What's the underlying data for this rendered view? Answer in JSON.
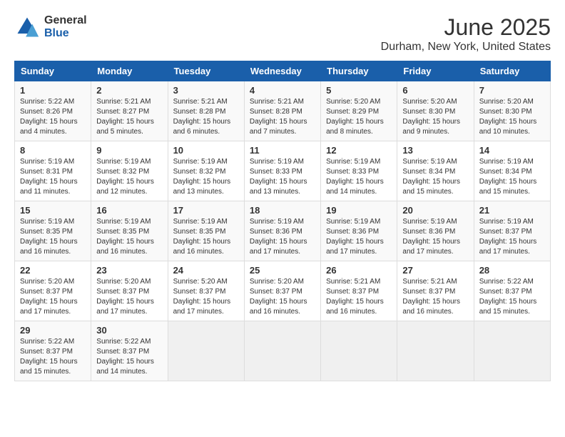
{
  "logo": {
    "general": "General",
    "blue": "Blue"
  },
  "title": "June 2025",
  "subtitle": "Durham, New York, United States",
  "weekdays": [
    "Sunday",
    "Monday",
    "Tuesday",
    "Wednesday",
    "Thursday",
    "Friday",
    "Saturday"
  ],
  "weeks": [
    [
      {
        "day": "1",
        "sunrise": "5:22 AM",
        "sunset": "8:26 PM",
        "daylight": "15 hours and 4 minutes."
      },
      {
        "day": "2",
        "sunrise": "5:21 AM",
        "sunset": "8:27 PM",
        "daylight": "15 hours and 5 minutes."
      },
      {
        "day": "3",
        "sunrise": "5:21 AM",
        "sunset": "8:28 PM",
        "daylight": "15 hours and 6 minutes."
      },
      {
        "day": "4",
        "sunrise": "5:21 AM",
        "sunset": "8:28 PM",
        "daylight": "15 hours and 7 minutes."
      },
      {
        "day": "5",
        "sunrise": "5:20 AM",
        "sunset": "8:29 PM",
        "daylight": "15 hours and 8 minutes."
      },
      {
        "day": "6",
        "sunrise": "5:20 AM",
        "sunset": "8:30 PM",
        "daylight": "15 hours and 9 minutes."
      },
      {
        "day": "7",
        "sunrise": "5:20 AM",
        "sunset": "8:30 PM",
        "daylight": "15 hours and 10 minutes."
      }
    ],
    [
      {
        "day": "8",
        "sunrise": "5:19 AM",
        "sunset": "8:31 PM",
        "daylight": "15 hours and 11 minutes."
      },
      {
        "day": "9",
        "sunrise": "5:19 AM",
        "sunset": "8:32 PM",
        "daylight": "15 hours and 12 minutes."
      },
      {
        "day": "10",
        "sunrise": "5:19 AM",
        "sunset": "8:32 PM",
        "daylight": "15 hours and 13 minutes."
      },
      {
        "day": "11",
        "sunrise": "5:19 AM",
        "sunset": "8:33 PM",
        "daylight": "15 hours and 13 minutes."
      },
      {
        "day": "12",
        "sunrise": "5:19 AM",
        "sunset": "8:33 PM",
        "daylight": "15 hours and 14 minutes."
      },
      {
        "day": "13",
        "sunrise": "5:19 AM",
        "sunset": "8:34 PM",
        "daylight": "15 hours and 15 minutes."
      },
      {
        "day": "14",
        "sunrise": "5:19 AM",
        "sunset": "8:34 PM",
        "daylight": "15 hours and 15 minutes."
      }
    ],
    [
      {
        "day": "15",
        "sunrise": "5:19 AM",
        "sunset": "8:35 PM",
        "daylight": "15 hours and 16 minutes."
      },
      {
        "day": "16",
        "sunrise": "5:19 AM",
        "sunset": "8:35 PM",
        "daylight": "15 hours and 16 minutes."
      },
      {
        "day": "17",
        "sunrise": "5:19 AM",
        "sunset": "8:35 PM",
        "daylight": "15 hours and 16 minutes."
      },
      {
        "day": "18",
        "sunrise": "5:19 AM",
        "sunset": "8:36 PM",
        "daylight": "15 hours and 17 minutes."
      },
      {
        "day": "19",
        "sunrise": "5:19 AM",
        "sunset": "8:36 PM",
        "daylight": "15 hours and 17 minutes."
      },
      {
        "day": "20",
        "sunrise": "5:19 AM",
        "sunset": "8:36 PM",
        "daylight": "15 hours and 17 minutes."
      },
      {
        "day": "21",
        "sunrise": "5:19 AM",
        "sunset": "8:37 PM",
        "daylight": "15 hours and 17 minutes."
      }
    ],
    [
      {
        "day": "22",
        "sunrise": "5:20 AM",
        "sunset": "8:37 PM",
        "daylight": "15 hours and 17 minutes."
      },
      {
        "day": "23",
        "sunrise": "5:20 AM",
        "sunset": "8:37 PM",
        "daylight": "15 hours and 17 minutes."
      },
      {
        "day": "24",
        "sunrise": "5:20 AM",
        "sunset": "8:37 PM",
        "daylight": "15 hours and 17 minutes."
      },
      {
        "day": "25",
        "sunrise": "5:20 AM",
        "sunset": "8:37 PM",
        "daylight": "15 hours and 16 minutes."
      },
      {
        "day": "26",
        "sunrise": "5:21 AM",
        "sunset": "8:37 PM",
        "daylight": "15 hours and 16 minutes."
      },
      {
        "day": "27",
        "sunrise": "5:21 AM",
        "sunset": "8:37 PM",
        "daylight": "15 hours and 16 minutes."
      },
      {
        "day": "28",
        "sunrise": "5:22 AM",
        "sunset": "8:37 PM",
        "daylight": "15 hours and 15 minutes."
      }
    ],
    [
      {
        "day": "29",
        "sunrise": "5:22 AM",
        "sunset": "8:37 PM",
        "daylight": "15 hours and 15 minutes."
      },
      {
        "day": "30",
        "sunrise": "5:22 AM",
        "sunset": "8:37 PM",
        "daylight": "15 hours and 14 minutes."
      },
      null,
      null,
      null,
      null,
      null
    ]
  ]
}
